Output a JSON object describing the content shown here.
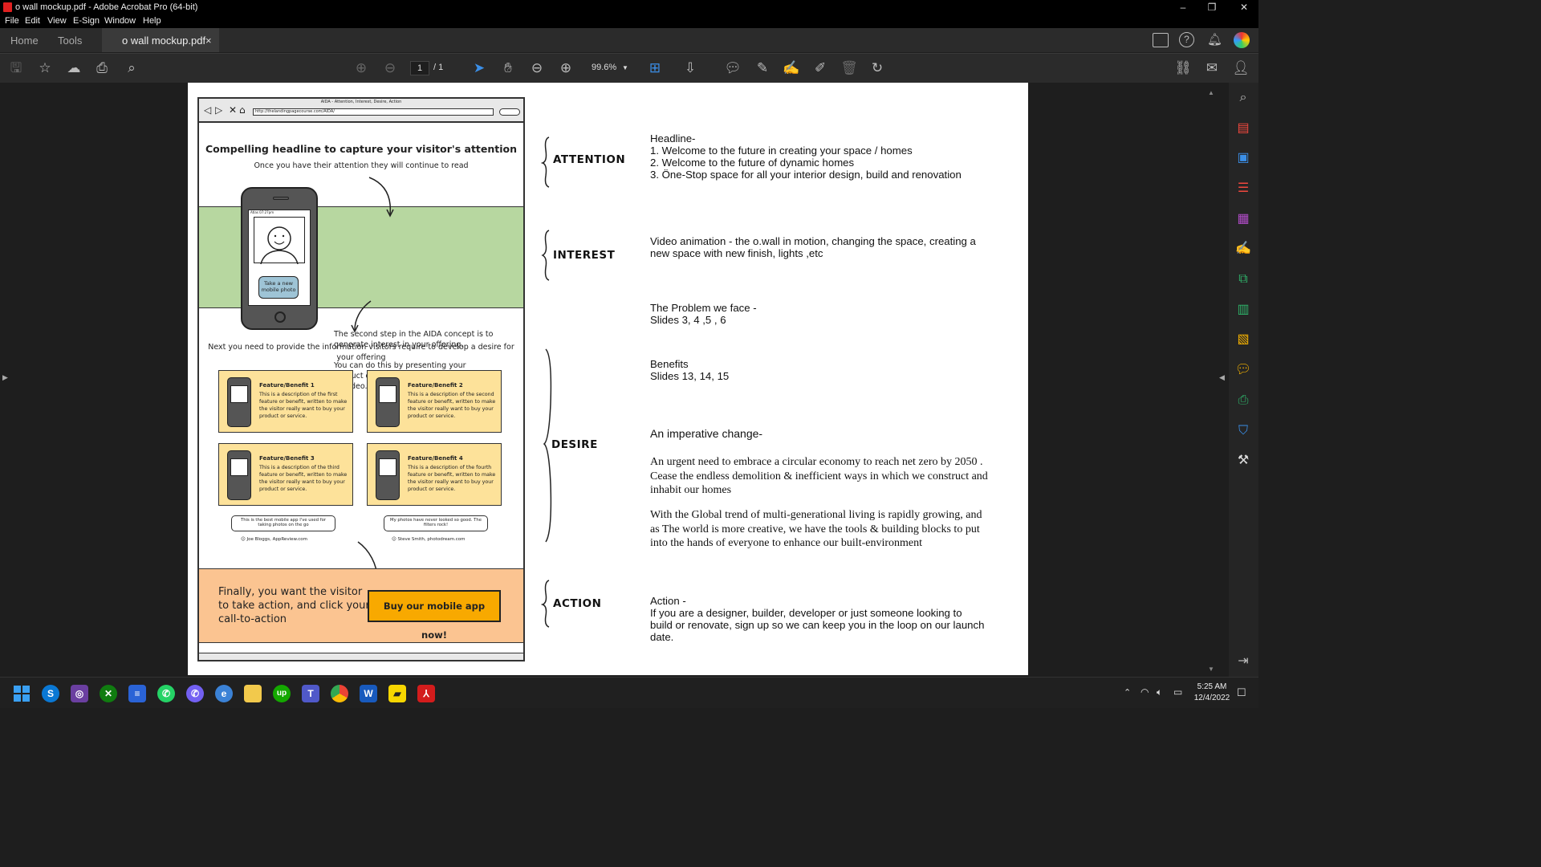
{
  "window": {
    "title": "o wall mockup.pdf - Adobe Acrobat Pro (64-bit)",
    "minimize": "–",
    "maximize": "❐",
    "close": "✕"
  },
  "menu": [
    "File",
    "Edit",
    "View",
    "E-Sign",
    "Window",
    "Help"
  ],
  "tabs": {
    "home": "Home",
    "tools": "Tools",
    "doc": "o wall mockup.pdf",
    "doc_close": "×"
  },
  "toolbar": {
    "page_current": "1",
    "page_total": "/ 1",
    "zoom": "99.6%"
  },
  "mockup": {
    "window_title": "AIDA - Attention, Interest, Desire, Action",
    "url": "http://thelandingpagecourse.com/AIDA/",
    "headline": "Compelling headline to capture your visitor's attention",
    "subhead": "Once you have their attention they will continue to read",
    "phone_status": "Atlas 07:27pm",
    "take_photo": "Take a new mobile photo",
    "interest_1": "The second step in the AIDA concept is to generate interest in your offering.",
    "interest_2": "You can do this by presenting your product or service in the form of a photo or video.",
    "desire_text": "Next you need to provide the information visitors require to develop a desire for your offering",
    "cards": [
      {
        "title": "Feature/Benefit 1",
        "desc": "This is a description of the first feature or benefit, written to make the visitor really want to buy your product or service."
      },
      {
        "title": "Feature/Benefit 2",
        "desc": "This is a description of the second feature or benefit, written to make the visitor really want to buy your product or service."
      },
      {
        "title": "Feature/Benefit 3",
        "desc": "This is a description of the third feature or benefit, written to make the visitor really want to buy your product or service."
      },
      {
        "title": "Feature/Benefit 4",
        "desc": "This is a description of the fourth feature or benefit, written to make the visitor really want to buy your product or service."
      }
    ],
    "quotes": [
      {
        "text": "This is the best mobile app I've used for taking photos on the go",
        "author": "Joe Bloggs, AppReview.com"
      },
      {
        "text": "My photos have never looked so good. The filters rock!",
        "author": "Steve Smith, photodream.com"
      }
    ],
    "action_text": "Finally, you want the visitor to take action, and click your call-to-action",
    "cta": "Buy our mobile app now!"
  },
  "labels": {
    "attention": "ATTENTION",
    "interest": "INTEREST",
    "desire": "DESIRE",
    "action": "ACTION"
  },
  "notes": {
    "headline_title": "Headline-",
    "headline_1": "1.   Welcome to the future in creating your space / homes",
    "headline_2": "2. Welcome to the future of dynamic homes",
    "headline_3": "3.  Öne-Stop space for all your interior design, build and renovation",
    "video": "Video animation - the o.wall in motion, changing the space, creating a new space with new finish, lights ,etc",
    "problem_title": "The Problem we face -",
    "problem_slides": "Slides 3, 4 ,5 , 6",
    "benefits_title": "Benefits",
    "benefits_slides": "Slides 13, 14, 15",
    "imperative_title": "An imperative change-",
    "imperative_1": "An urgent need to embrace a circular economy to reach net zero by 2050 . Cease the endless demolition & inefficient ways in which we construct and inhabit our homes",
    "imperative_2": "With the Global trend of multi-generational living is rapidly growing, and as The world is more creative, we have the tools & building blocks to put into the hands of everyone to enhance our built-environment",
    "action_title": "Action -",
    "action_body": "If you are a designer, builder, developer or just someone looking to build or renovate, sign up so we can keep you in the loop on our launch date."
  },
  "taskbar": {
    "time": "5:25 AM",
    "date": "12/4/2022"
  },
  "colors": {
    "accent": "#3b8fe8",
    "green_band": "#b7d7a0",
    "card": "#fde29a",
    "action_band": "#fbc491",
    "cta": "#f8a900"
  }
}
